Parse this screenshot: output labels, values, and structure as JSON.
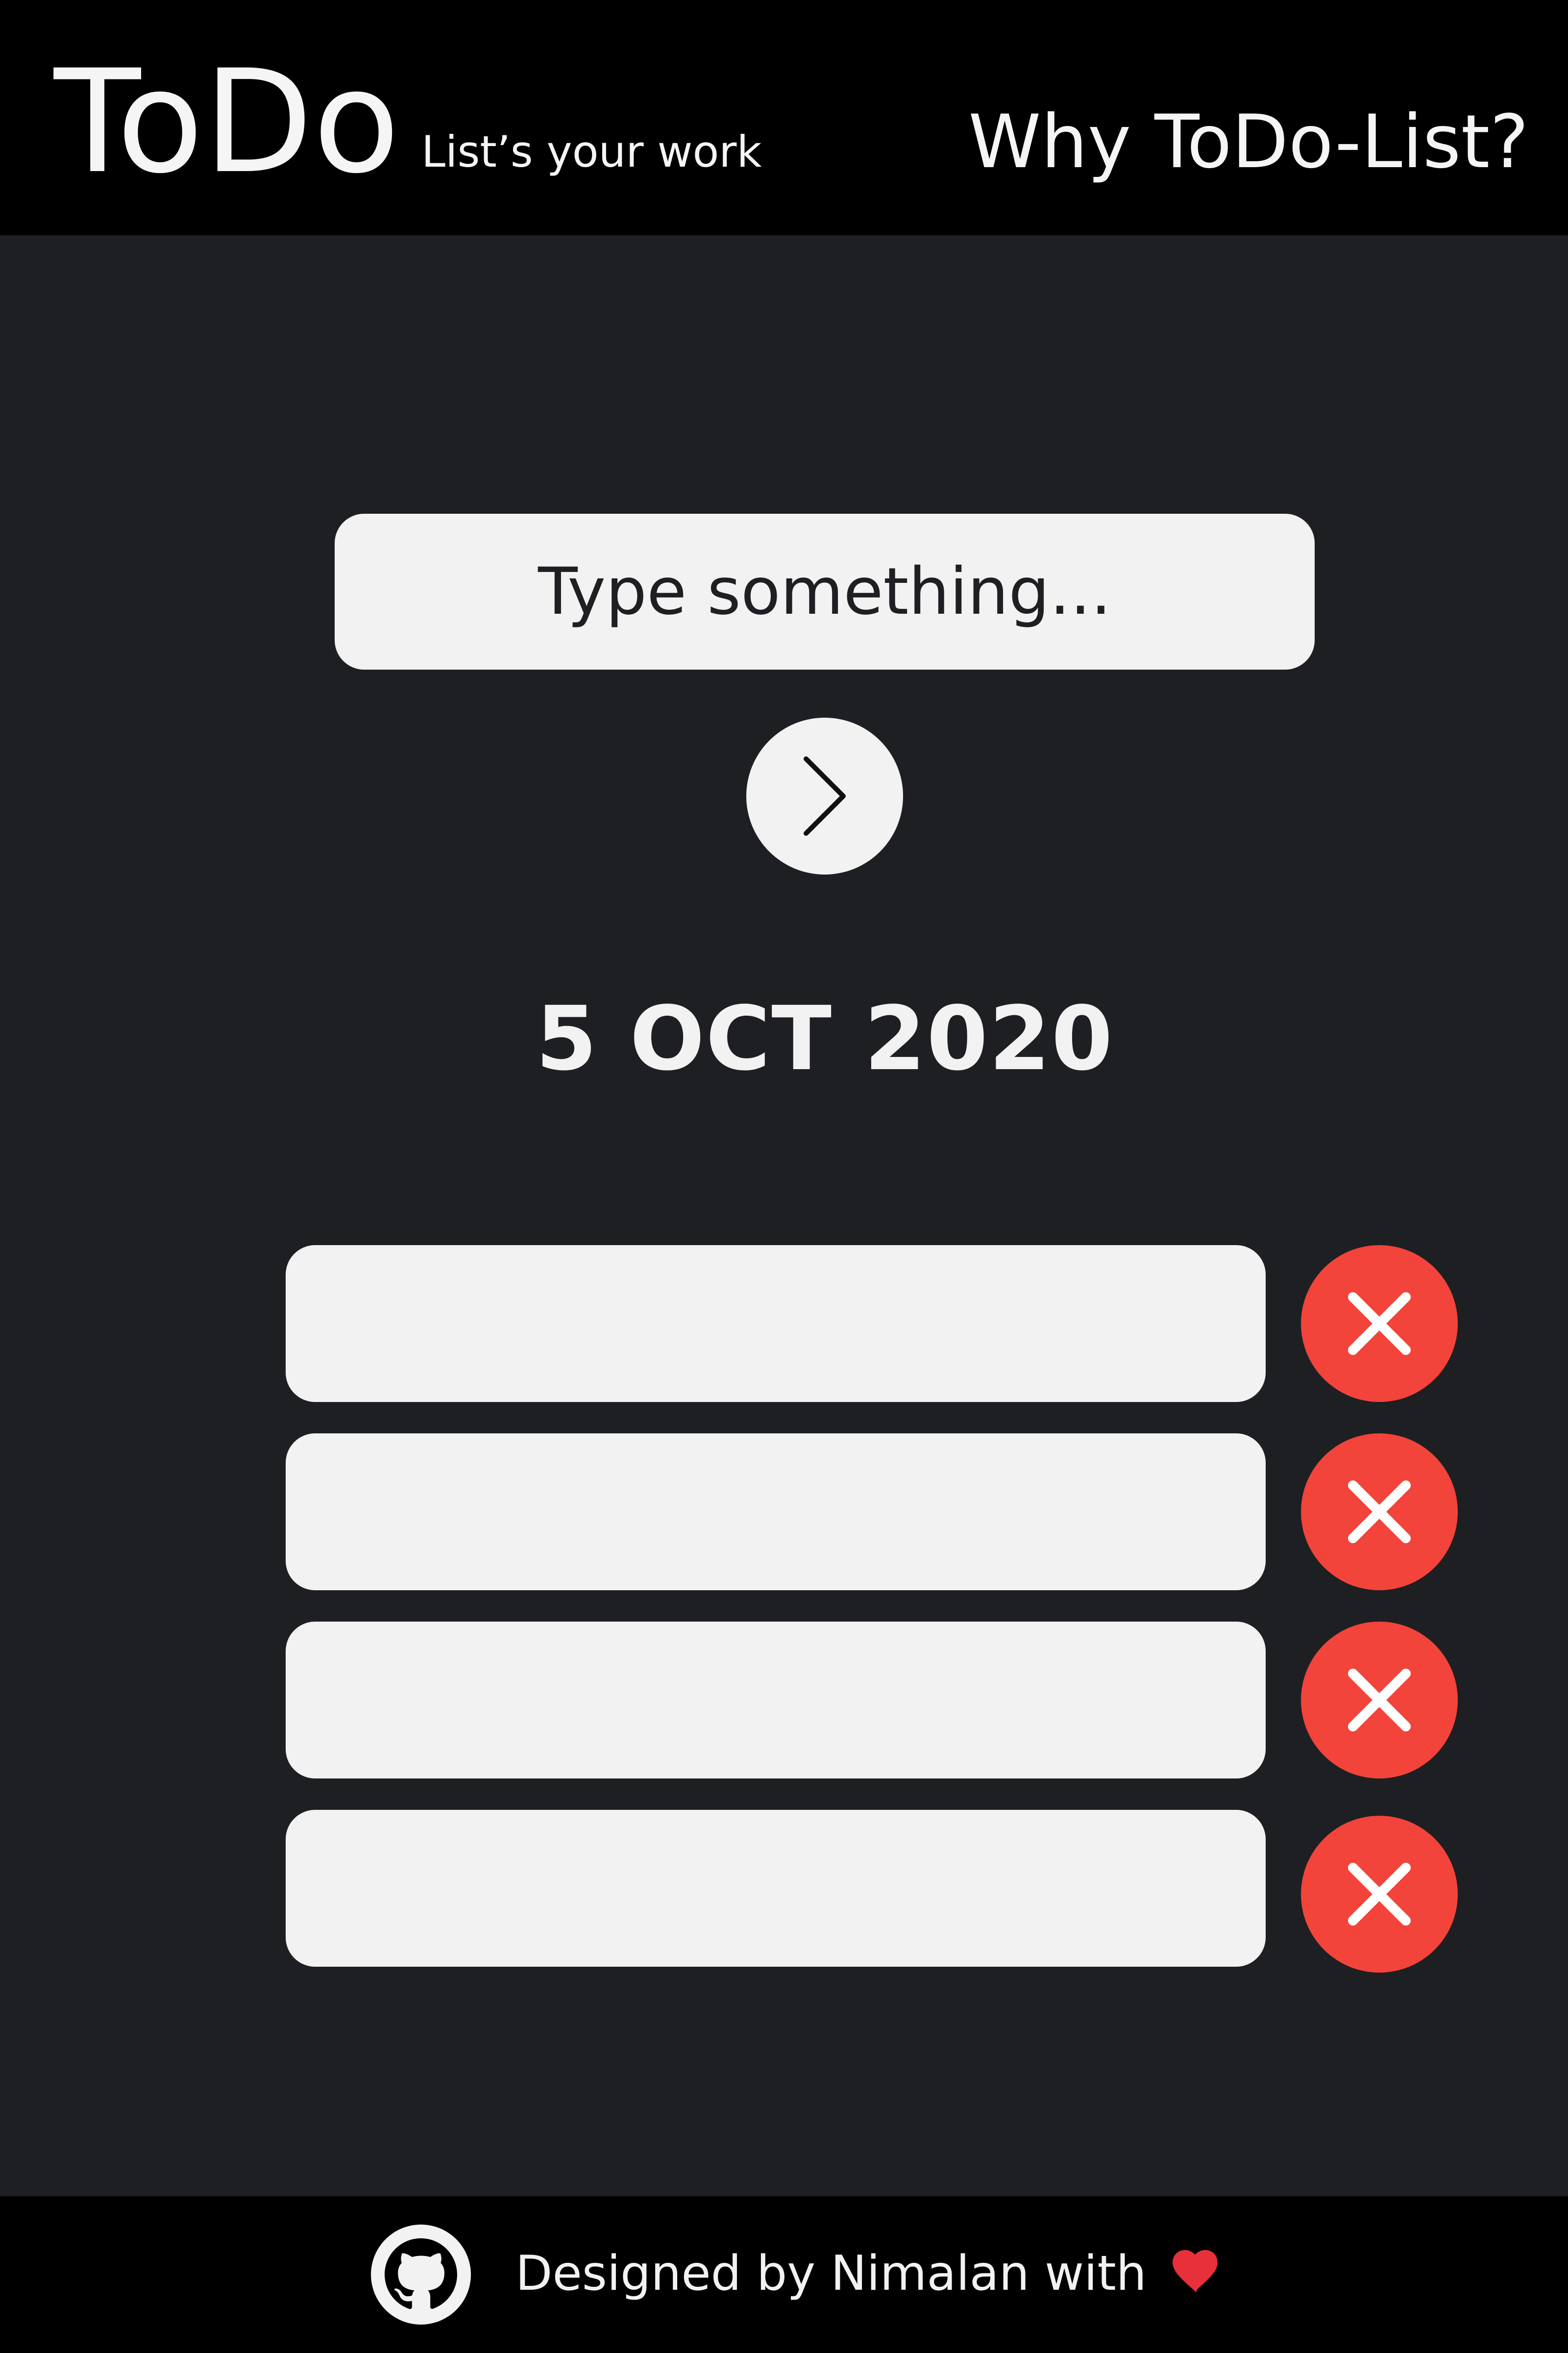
{
  "header": {
    "brand": "ToDo",
    "tagline": "List’s your work",
    "why_link": "Why ToDo-List?"
  },
  "input": {
    "placeholder": "Type something...",
    "value": ""
  },
  "submit": {
    "icon": "chevron-right-icon"
  },
  "date": "5 OCT 2020",
  "todos": [
    {
      "text": ""
    },
    {
      "text": ""
    },
    {
      "text": ""
    },
    {
      "text": ""
    }
  ],
  "footer": {
    "credit": "Designed by Nimalan with",
    "icon": "github-icon",
    "heart": "heart-icon"
  },
  "colors": {
    "background": "#1e1f22",
    "bar": "#000000",
    "surface": "#f2f2f2",
    "delete": "#f2443a"
  }
}
